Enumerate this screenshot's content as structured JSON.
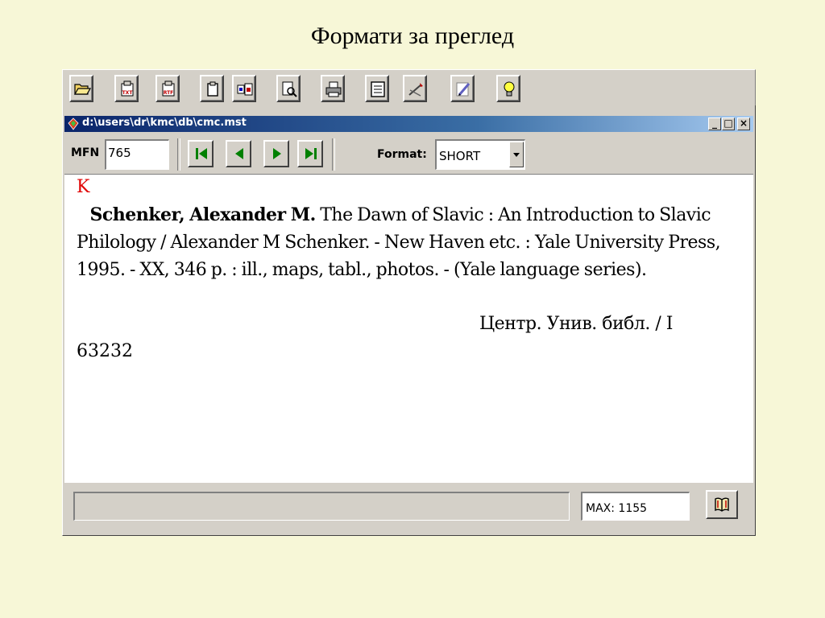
{
  "slide": {
    "title": "Формати за преглед"
  },
  "toolbar": {
    "buttons": [
      {
        "icon": "open-folder-icon"
      },
      {
        "icon": "export-txt-icon",
        "label": "TXT"
      },
      {
        "icon": "export-rtf-icon",
        "label": "RTF"
      },
      {
        "icon": "clipboard-icon"
      },
      {
        "icon": "copy-record-icon"
      },
      {
        "icon": "print-preview-icon"
      },
      {
        "icon": "printer-icon"
      },
      {
        "icon": "form-icon"
      },
      {
        "icon": "tools-icon"
      },
      {
        "icon": "edit-pencil-icon"
      },
      {
        "icon": "lightbulb-icon"
      }
    ]
  },
  "window": {
    "title": "d:\\users\\dr\\kmc\\db\\cmc.mst",
    "controls": {
      "minimize": "_",
      "maximize": "□",
      "close": "×"
    }
  },
  "nav": {
    "mfn_label": "MFN",
    "mfn_value": "765",
    "buttons": [
      "first-record",
      "previous-record",
      "next-record",
      "last-record"
    ],
    "format_label": "Format:",
    "format_value": "SHORT"
  },
  "record": {
    "index_letter": "K",
    "author": "Schenker, Alexander M.",
    "body": " The Dawn of Slavic : An Introduction to Slavic Philology / Alexander M Schenker. - New Haven etc. : Yale University Press, 1995. - XX, 346 p. : ill., maps, tabl., photos. - (Yale language series).",
    "location": "Центр. Унив. библ. / I",
    "inventory": "63232"
  },
  "status": {
    "message": "",
    "max_label": "MAX: 1155"
  },
  "colors": {
    "page_background": "#f7f7d7",
    "title_bar": "#0a246a",
    "index_letter": "#e00000"
  }
}
